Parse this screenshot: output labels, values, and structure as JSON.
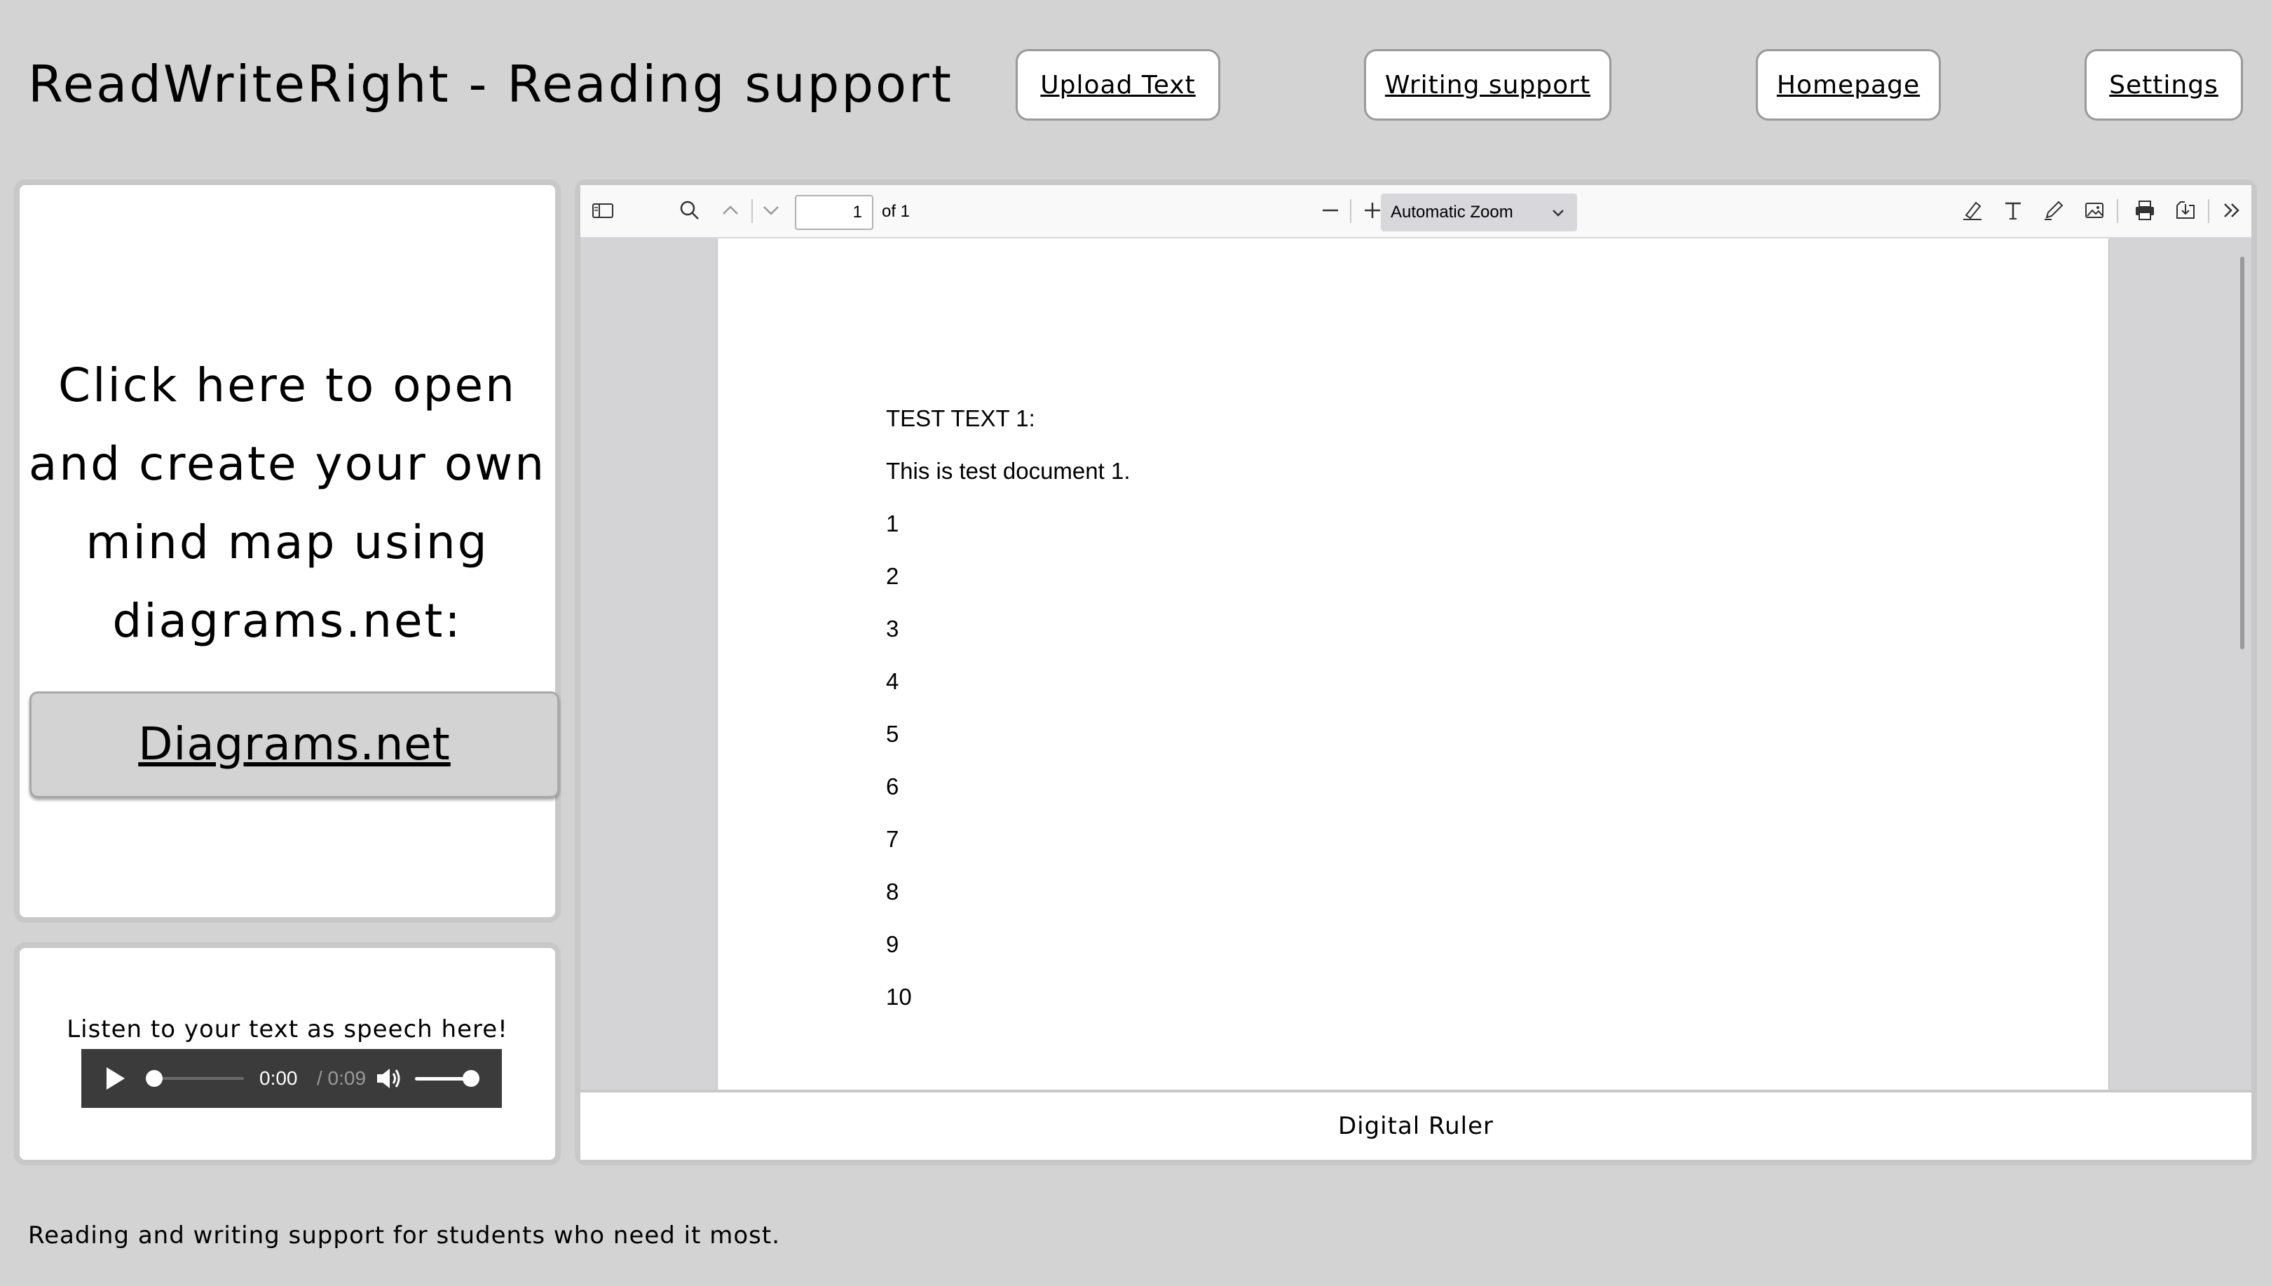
{
  "header": {
    "title": "ReadWriteRight - Reading support",
    "nav": {
      "upload": "Upload Text",
      "writing": "Writing support",
      "home": "Homepage",
      "settings": "Settings"
    }
  },
  "mindmap": {
    "prompt": "Click here to open and create your own mind map using diagrams.net:",
    "button_label": "Diagrams.net"
  },
  "audio": {
    "label": "Listen to your text as speech here!",
    "current_time": "0:00",
    "duration": "/ 0:09",
    "progress": 0.0,
    "volume": 1.0
  },
  "pdf_viewer": {
    "page_number": "1",
    "page_total": "of 1",
    "zoom": "Automatic Zoom",
    "icons": {
      "sidebar": "sidebar-toggle-icon",
      "find": "search-icon",
      "prev": "chevron-up-icon",
      "next": "chevron-down-icon",
      "zoom_out": "minus-icon",
      "zoom_in": "plus-icon",
      "highlight": "highlighter-icon",
      "text": "text-tool-icon",
      "draw": "pencil-icon",
      "image": "image-icon",
      "print": "printer-icon",
      "download": "download-icon",
      "tools": "double-chevron-right-icon"
    },
    "document": {
      "lines": [
        "TEST TEXT 1:",
        "This is test document 1.",
        "1",
        "2",
        "3",
        "4",
        "5",
        "6",
        "7",
        "8",
        "9",
        "10"
      ]
    }
  },
  "ruler": {
    "label": "Digital Ruler"
  },
  "footer": {
    "text": "Reading and writing support for students who need it most."
  }
}
